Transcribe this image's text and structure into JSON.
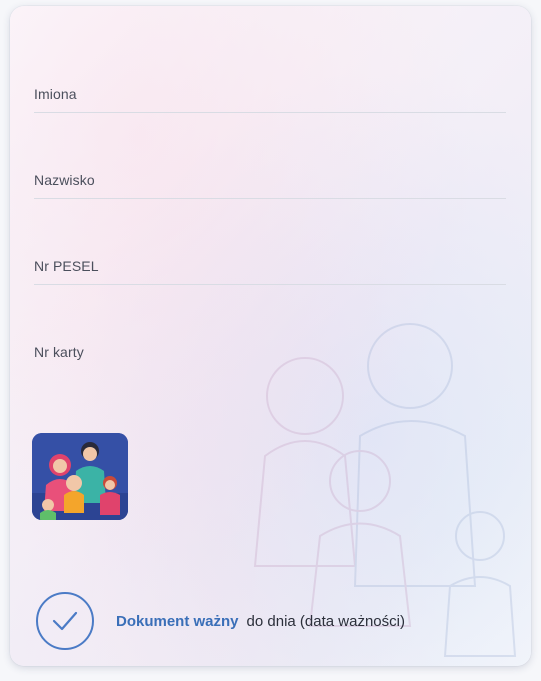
{
  "fields": [
    {
      "label": "Imiona"
    },
    {
      "label": "Nazwisko"
    },
    {
      "label": "Nr PESEL"
    },
    {
      "label": "Nr karty"
    }
  ],
  "photo": {
    "icon": "family-illustration"
  },
  "validity": {
    "status_label": "Dokument ważny",
    "date_label": "do dnia (data ważności)",
    "icon": "checkmark-circle-icon"
  },
  "colors": {
    "accent": "#3a6fb8",
    "text": "#4b4f5c",
    "divider": "#d9dce4"
  }
}
